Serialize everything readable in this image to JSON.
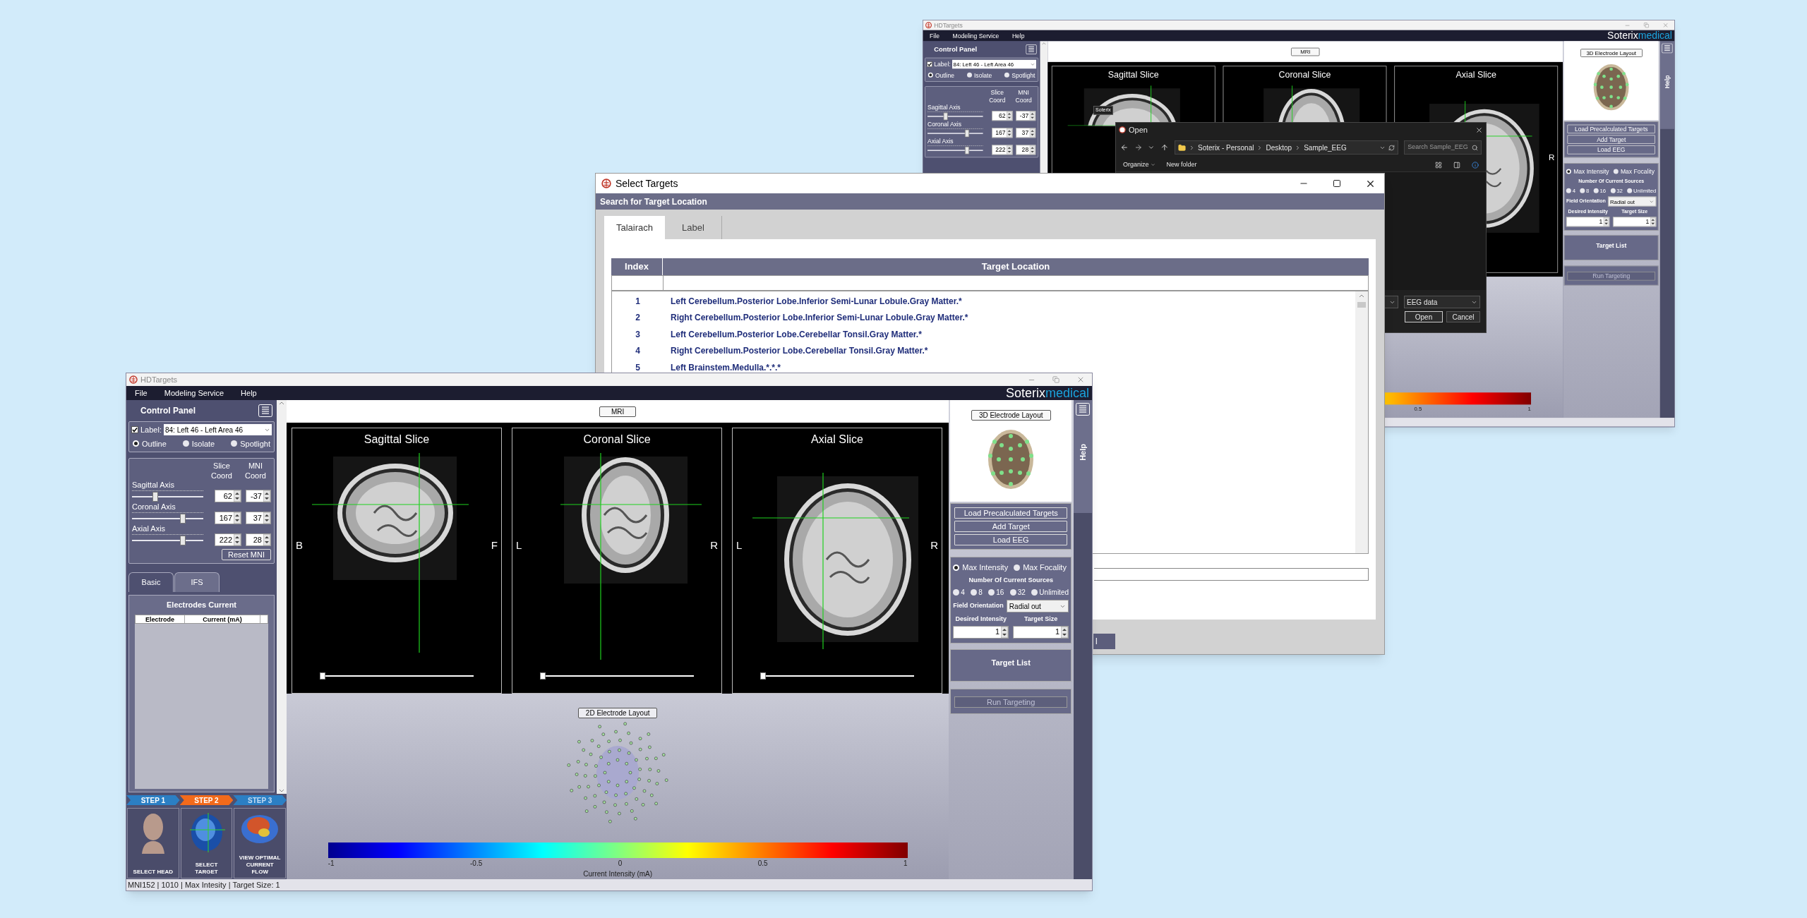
{
  "back_window": {
    "title": "HDTargets",
    "menu": [
      "File",
      "Modeling Service",
      "Help"
    ],
    "logo": [
      "Soterix",
      "medical"
    ],
    "control_panel": {
      "title": "Control Panel",
      "label_checked": true,
      "label_text": "Label:",
      "label_value": "84: Left 46 - Left Area 46",
      "display_modes": [
        {
          "label": "Outline",
          "selected": true
        },
        {
          "label": "Isolate",
          "selected": false
        },
        {
          "label": "Spotlight",
          "selected": false
        }
      ],
      "coord_headers": [
        "Slice Coord",
        "MNI Coord"
      ],
      "axes": [
        {
          "name": "Sagittal Axis",
          "level": 0.31,
          "slice": "62",
          "mni": "-37"
        },
        {
          "name": "Coronal Axis",
          "level": 0.73,
          "slice": "167",
          "mni": "37"
        },
        {
          "name": "Axial Axis",
          "level": 0.73,
          "slice": "222",
          "mni": "28"
        }
      ]
    },
    "mri_button": "MRI",
    "slices": [
      {
        "title": "Sagittal Slice",
        "kind": "sagittal",
        "tooltip": "Soterix"
      },
      {
        "title": "Coronal Slice",
        "kind": "coronal"
      },
      {
        "title": "Axial Slice",
        "kind": "axial",
        "right": "R"
      }
    ],
    "colorbar": {
      "ticks": [
        "0.5",
        "1"
      ]
    },
    "right_panel": {
      "layout_button": "3D Electrode Layout",
      "actions": [
        "Load Precalculated Targets",
        "Add Target",
        "Load EEG"
      ],
      "modes": [
        {
          "label": "Max Intensity",
          "selected": true
        },
        {
          "label": "Max Focality",
          "selected": false
        }
      ],
      "sources_title": "Number Of Current Sources",
      "sources": [
        {
          "label": "4",
          "selected": false
        },
        {
          "label": "8",
          "selected": false
        },
        {
          "label": "16",
          "selected": false
        },
        {
          "label": "32",
          "selected": false
        },
        {
          "label": "Unlimited",
          "selected": false
        }
      ],
      "field_orientation": {
        "label": "Field Orientation",
        "value": "Radial out"
      },
      "desired_intensity": {
        "label": "Desired Intensity",
        "value": "1"
      },
      "target_size": {
        "label": "Target Size",
        "value": "1"
      },
      "target_list_title": "Target List",
      "run_button": {
        "label": "Run Targeting",
        "disabled": true
      }
    },
    "help_label": "Help"
  },
  "open_dialog": {
    "title": "Open",
    "path": [
      "Soterix - Personal",
      "Desktop",
      "Sample_EEG"
    ],
    "search_placeholder": "Search Sample_EEG",
    "toolbar": [
      "Organize",
      "New folder"
    ],
    "file_type": "EEG data",
    "buttons": [
      "Open",
      "Cancel"
    ]
  },
  "select_targets": {
    "title": "Select Targets",
    "header": "Search for Target Location",
    "tabs": [
      {
        "label": "Talairach",
        "selected": true
      },
      {
        "label": "Label",
        "selected": false
      }
    ],
    "columns": [
      "Index",
      "Target Location"
    ],
    "rows": [
      {
        "index": "1",
        "location": "Left Cerebellum.Posterior Lobe.Inferior Semi-Lunar Lobule.Gray Matter.*"
      },
      {
        "index": "2",
        "location": "Right Cerebellum.Posterior Lobe.Inferior Semi-Lunar Lobule.Gray Matter.*"
      },
      {
        "index": "3",
        "location": "Left Cerebellum.Posterior Lobe.Cerebellar Tonsil.Gray Matter.*"
      },
      {
        "index": "4",
        "location": "Right Cerebellum.Posterior Lobe.Cerebellar Tonsil.Gray Matter.*"
      },
      {
        "index": "5",
        "location": "Left Brainstem.Medulla.*.*.*"
      }
    ],
    "button": "l"
  },
  "main_window": {
    "title": "HDTargets",
    "menu": [
      "File",
      "Modeling Service",
      "Help"
    ],
    "logo": [
      "Soterix",
      "medical"
    ],
    "control_panel": {
      "title": "Control Panel",
      "label_checked": true,
      "label_text": "Label:",
      "label_value": "84: Left 46 - Left Area 46",
      "display_modes": [
        {
          "label": "Outline",
          "selected": true
        },
        {
          "label": "Isolate",
          "selected": false
        },
        {
          "label": "Spotlight",
          "selected": false
        }
      ],
      "coord_headers": [
        "Slice Coord",
        "MNI Coord"
      ],
      "axes": [
        {
          "name": "Sagittal Axis",
          "level": 0.31,
          "slice": "62",
          "mni": "-37"
        },
        {
          "name": "Coronal Axis",
          "level": 0.73,
          "slice": "167",
          "mni": "37"
        },
        {
          "name": "Axial Axis",
          "level": 0.73,
          "slice": "222",
          "mni": "28"
        }
      ],
      "reset_button": "Reset MNI",
      "tabs": [
        {
          "label": "Basic",
          "selected": true
        },
        {
          "label": "IFS",
          "selected": false
        }
      ],
      "electrodes": {
        "title": "Electrodes Current",
        "columns": [
          "Electrode",
          "Current (mA)"
        ]
      },
      "steps": [
        {
          "label": "STEP 1",
          "selected": false,
          "disabled": false,
          "tile": "SELECT HEAD",
          "kind": "head"
        },
        {
          "label": "STEP 2",
          "selected": true,
          "disabled": false,
          "tile": "SELECT TARGET",
          "kind": "scan"
        },
        {
          "label": "STEP 3",
          "selected": false,
          "disabled": true,
          "tile": "VIEW OPTIMAL CURRENT FLOW",
          "kind": "brain"
        }
      ]
    },
    "mri_button": "MRI",
    "slices": [
      {
        "title": "Sagittal Slice",
        "kind": "sagittal",
        "left": "B",
        "right": "F",
        "slider": {
          "level": 0
        }
      },
      {
        "title": "Coronal Slice",
        "kind": "coronal",
        "left": "L",
        "right": "R",
        "slider": {
          "level": 0
        }
      },
      {
        "title": "Axial Slice",
        "kind": "axial",
        "left": "L",
        "right": "R",
        "slider": {
          "level": 0
        }
      }
    ],
    "layout_2d_button": "2D Electrode Layout",
    "colorbar": {
      "ticks": [
        "-1",
        "-0.5",
        "0",
        "0.5",
        "1"
      ],
      "caption": "Current Intensity (mA)"
    },
    "right_panel": {
      "layout_button": "3D Electrode Layout",
      "actions": [
        "Load Precalculated Targets",
        "Add Target",
        "Load EEG"
      ],
      "modes": [
        {
          "label": "Max Intensity",
          "selected": true
        },
        {
          "label": "Max Focality",
          "selected": false
        }
      ],
      "sources_title": "Number Of Current Sources",
      "sources": [
        {
          "label": "4",
          "selected": false
        },
        {
          "label": "8",
          "selected": false
        },
        {
          "label": "16",
          "selected": false
        },
        {
          "label": "32",
          "selected": false
        },
        {
          "label": "Unlimited",
          "selected": false
        }
      ],
      "field_orientation": {
        "label": "Field Orientation",
        "value": "Radial out"
      },
      "desired_intensity": {
        "label": "Desired Intensity",
        "value": "1"
      },
      "target_size": {
        "label": "Target Size",
        "value": "1"
      },
      "target_list_title": "Target List",
      "run_button": {
        "label": "Run Targeting",
        "disabled": true
      }
    },
    "help_label": "Help",
    "status": "MNI152 | 1010 | Max Intesity | Target Size: 1"
  }
}
